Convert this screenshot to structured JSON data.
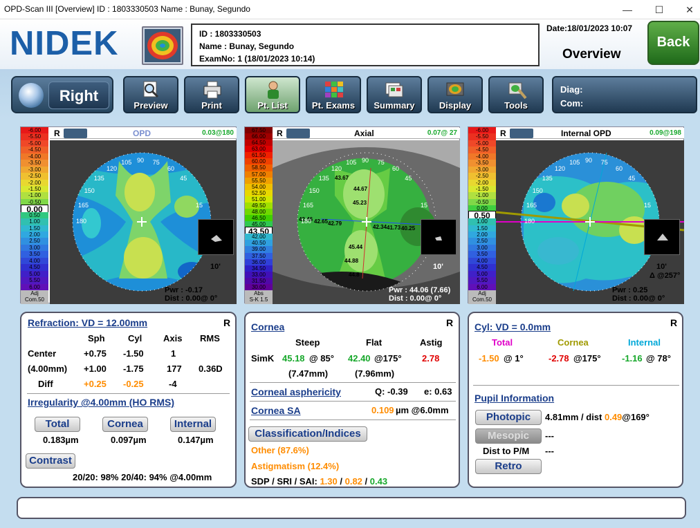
{
  "window": {
    "title": "OPD-Scan III  [Overview]  ID : 1803330503  Name : Bunay,  Segundo",
    "min": "—",
    "max": "☐",
    "close": "✕"
  },
  "header": {
    "logo": "NIDEK",
    "id_line": "ID : 1803330503",
    "name_line": "Name : Bunay,  Segundo",
    "exam_line": "ExamNo: 1 (18/01/2023 10:14)",
    "date": "Date:18/01/2023 10:07",
    "title": "Overview",
    "back": "Back"
  },
  "toolbar": {
    "eye": "Right",
    "buttons": [
      "Preview",
      "Print",
      "Pt. List",
      "Pt. Exams",
      "Summary",
      "Display",
      "Tools"
    ],
    "diag": "Diag:",
    "com": "Com:"
  },
  "maps": [
    {
      "eye": "R",
      "title": "OPD",
      "value": "0.03@180",
      "scale_marker": "0.00",
      "foot1": "Adj",
      "foot2": "Com.50",
      "scale": [
        "-6.00",
        "-5.50",
        "-5.00",
        "-4.50",
        "-4.00",
        "-3.50",
        "-3.00",
        "-2.50",
        "-2.00",
        "-1.50",
        "-1.00",
        "-0.50",
        "0.00",
        "0.50",
        "1.00",
        "1.50",
        "2.00",
        "2.50",
        "3.00",
        "3.50",
        "4.00",
        "4.50",
        "5.00",
        "5.50",
        "6.00"
      ],
      "pwr": "Pwr :  -0.17",
      "dist": "Dist :  0.00@  0°",
      "inset": "10'"
    },
    {
      "eye": "R",
      "title": "Axial",
      "value": "0.07@ 27",
      "scale_marker": "43.50",
      "foot1": "Abs",
      "foot2": "S-K 1.5",
      "scale": [
        "67.50",
        "66.00",
        "64.50",
        "63.00",
        "61.50",
        "60.00",
        "58.50",
        "57.00",
        "55.50",
        "54.00",
        "52.50",
        "51.00",
        "49.50",
        "48.00",
        "46.50",
        "45.00",
        "43.50",
        "42.00",
        "40.50",
        "39.00",
        "37.50",
        "36.00",
        "34.50",
        "33.00",
        "31.50",
        "30.00"
      ],
      "pwr": "Pwr :  44.06 (7.66)",
      "dist": "Dist :  0.00@  0°",
      "inset": "10'",
      "values": [
        "43.67",
        "44.67",
        "45.23",
        "42.46",
        "42.65",
        "42.79",
        "42.34",
        "41.73",
        "40.25",
        "45.44",
        "44.88",
        "44.8"
      ]
    },
    {
      "eye": "R",
      "title": "Internal OPD",
      "value": "0.09@198",
      "scale_marker": "0.50",
      "foot1": "Adj",
      "foot2": "Com.50",
      "scale": [
        "-6.00",
        "-5.50",
        "-5.00",
        "-4.50",
        "-4.00",
        "-3.50",
        "-3.00",
        "-2.50",
        "-2.00",
        "-1.50",
        "-1.00",
        "-0.50",
        "0.00",
        "0.50",
        "1.00",
        "1.50",
        "2.00",
        "2.50",
        "3.00",
        "3.50",
        "4.00",
        "4.50",
        "5.00",
        "5.50",
        "6.00"
      ],
      "pwr": "Pwr :  0.25",
      "dist": "Dist :  0.00@  0°",
      "inset": "10'",
      "delta": "Δ @257°"
    }
  ],
  "angles": [
    "90",
    "105",
    "75",
    "120",
    "60",
    "135",
    "45",
    "150",
    "165",
    "15",
    "180",
    "0"
  ],
  "refraction": {
    "title": "Refraction: VD = 12.00mm",
    "eye": "R",
    "headers": [
      "Sph",
      "Cyl",
      "Axis",
      "RMS"
    ],
    "rows": [
      {
        "label": "Center",
        "sph": "+0.75",
        "cyl": "-1.50",
        "axis": "1",
        "rms": ""
      },
      {
        "label": "(4.00mm)",
        "sph": "+1.00",
        "cyl": "-1.75",
        "axis": "177",
        "rms": "0.36D"
      },
      {
        "label": "Diff",
        "sph": "+0.25",
        "cyl": "-0.25",
        "axis": "-4",
        "rms": ""
      }
    ],
    "irr_title": "Irregularity @4.00mm (HO RMS)",
    "irr_buttons": [
      "Total",
      "Cornea",
      "Internal"
    ],
    "irr_values": [
      "0.183µm",
      "0.097µm",
      "0.147µm"
    ],
    "contrast": "Contrast",
    "contrast_line": "20/20: 98%  20/40: 94%  @4.00mm"
  },
  "cornea": {
    "title": "Cornea",
    "eye": "R",
    "headers": [
      "Steep",
      "Flat",
      "Astig"
    ],
    "simk": "SimK",
    "steep": "45.18",
    "steep_ax": "@ 85°",
    "flat": "42.40",
    "flat_ax": "@175°",
    "astig": "2.78",
    "steep_r": "(7.47mm)",
    "flat_r": "(7.96mm)",
    "asph": "Corneal asphericity",
    "q": "Q:  -0.39",
    "e": "e: 0.63",
    "sa": "Cornea SA",
    "sa_val": "0.109",
    "sa_unit": "µm @6.0mm",
    "class_btn": "Classification/Indices",
    "other": "Other (87.6%)",
    "astigm": "Astigmatism (12.4%)",
    "sdp_label": "SDP / SRI / SAI: ",
    "sdp": "1.30",
    "sri": "0.82",
    "sai": "0.43",
    "slash": " / "
  },
  "cyl": {
    "title": "Cyl: VD = 0.0mm",
    "eye": "R",
    "headers": [
      "Total",
      "Cornea",
      "Internal"
    ],
    "total": "-1.50",
    "total_ax": "@  1°",
    "cornea": "-2.78",
    "cornea_ax": "@175°",
    "internal": "-1.16",
    "internal_ax": "@ 78°",
    "pupil": "Pupil Information",
    "photopic": "Photopic",
    "photopic_val": "4.81mm / dist ",
    "photopic_d": "0.49",
    "photopic_ax": "@169°",
    "mesopic": "Mesopic",
    "mesopic_val": "---",
    "dist_pm": "Dist to P/M",
    "dist_pm_val": "---",
    "retro": "Retro"
  },
  "colors": {
    "accent": "#1a3d8a",
    "orange": "#ff8c00",
    "red": "#e00000",
    "green": "#17a82b",
    "olive": "#a09a00",
    "magenta": "#e000c8",
    "cyan": "#00a8d8"
  }
}
